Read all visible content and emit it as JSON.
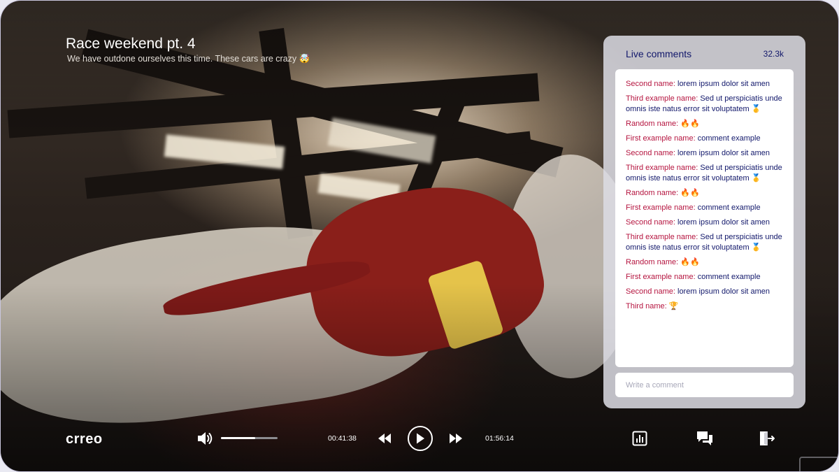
{
  "video": {
    "title": "Race weekend pt. 4",
    "subtitle": "We have outdone ourselves this time. These cars are crazy 🤯"
  },
  "live_comments": {
    "title": "Live comments",
    "count": "32.3k",
    "comments": [
      {
        "name": "Second name:",
        "text": " lorem ipsum dolor sit amen"
      },
      {
        "name": "Third example name:",
        "text": " Sed ut perspiciatis unde omnis iste natus error sit voluptatem 🥇"
      },
      {
        "name": "Random name:",
        "text": " 🔥🔥"
      },
      {
        "name": "First example name:",
        "text": " comment example"
      },
      {
        "name": "Second name:",
        "text": " lorem ipsum dolor sit amen"
      },
      {
        "name": "Third example name:",
        "text": " Sed ut perspiciatis unde omnis iste natus error sit voluptatem 🥇"
      },
      {
        "name": "Random name:",
        "text": " 🔥🔥"
      },
      {
        "name": "First example name:",
        "text": " comment example"
      },
      {
        "name": "Second name:",
        "text": " lorem ipsum dolor sit amen"
      },
      {
        "name": "Third example name:",
        "text": " Sed ut perspiciatis unde omnis iste natus error sit voluptatem 🥇"
      },
      {
        "name": "Random name:",
        "text": " 🔥🔥"
      },
      {
        "name": "First example name:",
        "text": " comment example"
      },
      {
        "name": "Second name:",
        "text": " lorem ipsum dolor sit amen"
      },
      {
        "name": "Third name:",
        "text": " 🏆"
      }
    ],
    "input_placeholder": "Write a comment"
  },
  "controls": {
    "logo": "crreo",
    "volume_level": 0.6,
    "current_time": "00:41:38",
    "total_time": "01:56:14",
    "icons": {
      "volume": "volume-icon",
      "rewind": "rewind-icon",
      "play": "play-icon",
      "forward": "fast-forward-icon",
      "stats": "bar-chart-icon",
      "chat": "chat-bubbles-icon",
      "exit": "exit-icon"
    }
  },
  "colors": {
    "name": "#b5143f",
    "text": "#12186b",
    "panel": "#dcdce4"
  }
}
